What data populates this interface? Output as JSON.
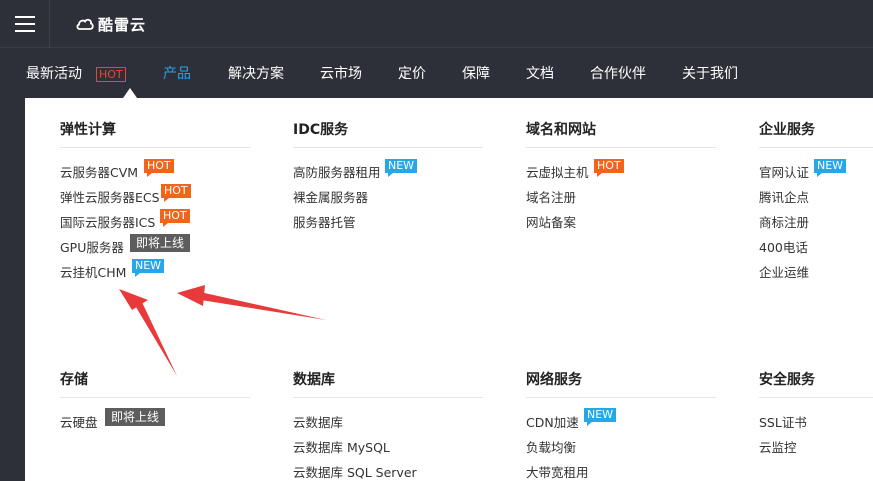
{
  "header": {
    "brand": "酷雷云"
  },
  "nav": {
    "items": [
      {
        "label": "最新活动",
        "badge": "HOT"
      },
      {
        "label": "产品",
        "active": true
      },
      {
        "label": "解决方案"
      },
      {
        "label": "云市场"
      },
      {
        "label": "定价"
      },
      {
        "label": "保障"
      },
      {
        "label": "文档"
      },
      {
        "label": "合作伙伴"
      },
      {
        "label": "关于我们"
      }
    ]
  },
  "colors": {
    "header_bg": "#2d3038",
    "active_nav": "#2d9fea",
    "hot_tag": "#f26419",
    "new_tag": "#26a7e8",
    "soon_tag": "#5d5d5d",
    "annotation_arrow": "#e83a3a"
  },
  "sections": [
    {
      "title": "弹性计算",
      "items": [
        {
          "label": "云服务器CVM",
          "tag": "HOT"
        },
        {
          "label": "弹性云服务器ECS",
          "tag": "HOT"
        },
        {
          "label": "国际云服务器ICS",
          "tag": "HOT"
        },
        {
          "label": "GPU服务器",
          "tag": "即将上线"
        },
        {
          "label": "云挂机CHM",
          "tag": "NEW"
        }
      ]
    },
    {
      "title": "IDC服务",
      "items": [
        {
          "label": "高防服务器租用",
          "tag": "NEW"
        },
        {
          "label": "裸金属服务器"
        },
        {
          "label": "服务器托管"
        }
      ]
    },
    {
      "title": "域名和网站",
      "items": [
        {
          "label": "云虚拟主机",
          "tag": "HOT"
        },
        {
          "label": "域名注册"
        },
        {
          "label": "网站备案"
        }
      ]
    },
    {
      "title": "企业服务",
      "items": [
        {
          "label": "官网认证",
          "tag": "NEW"
        },
        {
          "label": "腾讯企点"
        },
        {
          "label": "商标注册"
        },
        {
          "label": "400电话"
        },
        {
          "label": "企业运维"
        }
      ]
    },
    {
      "title": "存储",
      "items": [
        {
          "label": "云硬盘",
          "tag": "即将上线"
        }
      ]
    },
    {
      "title": "数据库",
      "items": [
        {
          "label": "云数据库"
        },
        {
          "label": "云数据库 MySQL"
        },
        {
          "label": "云数据库 SQL Server"
        }
      ]
    },
    {
      "title": "网络服务",
      "items": [
        {
          "label": "CDN加速",
          "tag": "NEW"
        },
        {
          "label": "负载均衡"
        },
        {
          "label": "大带宽租用"
        }
      ]
    },
    {
      "title": "安全服务",
      "items": [
        {
          "label": "SSL证书"
        },
        {
          "label": "云监控"
        }
      ]
    }
  ]
}
